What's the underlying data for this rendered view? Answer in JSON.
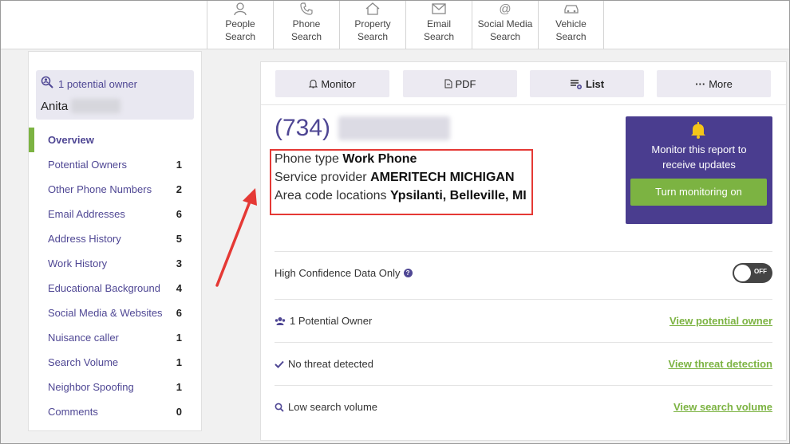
{
  "colors": {
    "brand": "#4f4794",
    "accent_green": "#7cb342",
    "monitor_bg": "#4a3d8f",
    "highlight_red": "#e53935"
  },
  "topnav": {
    "tabs": [
      {
        "label": "People\nSearch",
        "icon": "person-icon"
      },
      {
        "label": "Phone\nSearch",
        "icon": "phone-icon"
      },
      {
        "label": "Property\nSearch",
        "icon": "home-icon"
      },
      {
        "label": "Email\nSearch",
        "icon": "envelope-icon"
      },
      {
        "label": "Social Media\nSearch",
        "icon": "at-icon"
      },
      {
        "label": "Vehicle\nSearch",
        "icon": "car-icon"
      }
    ]
  },
  "sidebar": {
    "owner_card": {
      "count_text": "1 potential owner",
      "name": "Anita"
    },
    "items": [
      {
        "label": "Overview",
        "count": ""
      },
      {
        "label": "Potential Owners",
        "count": "1"
      },
      {
        "label": "Other Phone Numbers",
        "count": "2"
      },
      {
        "label": "Email Addresses",
        "count": "6"
      },
      {
        "label": "Address History",
        "count": "5"
      },
      {
        "label": "Work History",
        "count": "3"
      },
      {
        "label": "Educational Background",
        "count": "4"
      },
      {
        "label": "Social Media & Websites",
        "count": "6"
      },
      {
        "label": "Nuisance caller",
        "count": "1"
      },
      {
        "label": "Search Volume",
        "count": "1"
      },
      {
        "label": "Neighbor Spoofing",
        "count": "1"
      },
      {
        "label": "Comments",
        "count": "0"
      }
    ]
  },
  "toolbar": {
    "monitor": "Monitor",
    "pdf": "PDF",
    "list": "List",
    "more": "More"
  },
  "report": {
    "phone_prefix": "(734)",
    "phone_type_label": "Phone type",
    "phone_type_value": "Work Phone",
    "provider_label": "Service provider",
    "provider_value": "AMERITECH MICHIGAN",
    "area_label": "Area code locations",
    "area_value": "Ypsilanti, Belleville, MI"
  },
  "monitor_box": {
    "text": "Monitor this report to receive updates",
    "button": "Turn monitoring on"
  },
  "rows": {
    "confidence_label": "High Confidence Data Only",
    "toggle_state": "OFF",
    "owner_label": "1 Potential Owner",
    "owner_link": "View potential owner",
    "threat_label": "No threat detected",
    "threat_link": "View threat detection",
    "volume_label": "Low search volume",
    "volume_link": "View search volume"
  }
}
